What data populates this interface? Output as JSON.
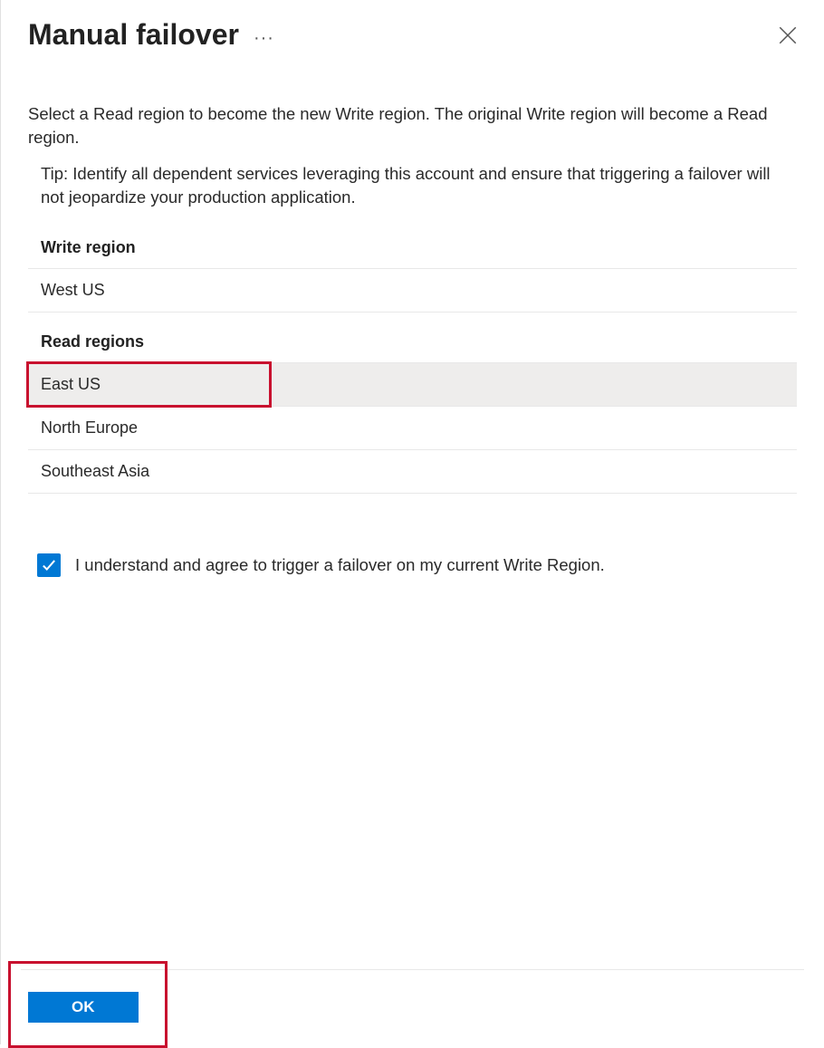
{
  "header": {
    "title": "Manual failover"
  },
  "content": {
    "description": "Select a Read region to become the new Write region. The original Write region will become a Read region.",
    "tip": "Tip: Identify all dependent services leveraging this account and ensure that triggering a failover will not jeopardize your production application.",
    "write_section_label": "Write region",
    "write_region": "West US",
    "read_section_label": "Read regions",
    "read_regions": [
      {
        "name": "East US",
        "selected": true
      },
      {
        "name": "North Europe",
        "selected": false
      },
      {
        "name": "Southeast Asia",
        "selected": false
      }
    ],
    "confirm_text": "I understand and agree to trigger a failover on my current Write Region.",
    "confirm_checked": true
  },
  "footer": {
    "ok_label": "OK"
  }
}
